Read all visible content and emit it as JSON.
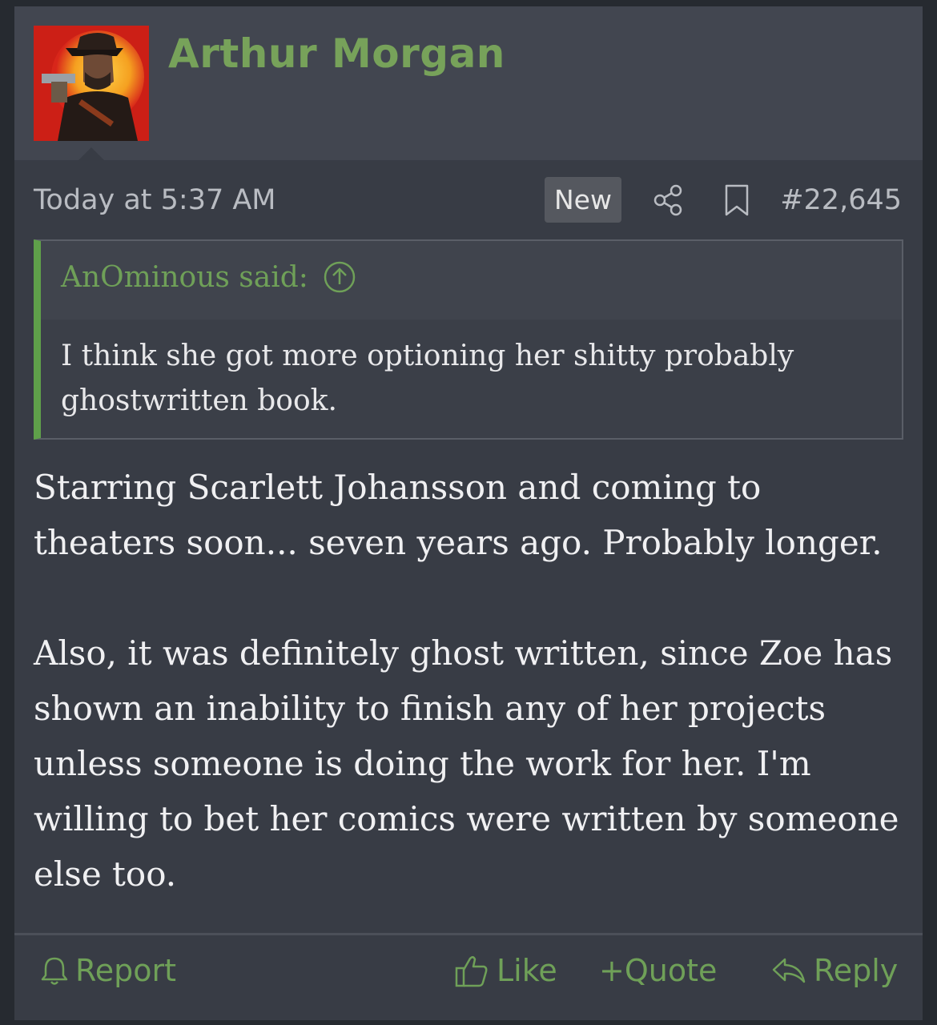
{
  "post": {
    "author": "Arthur Morgan",
    "date": "Today at 5:37 AM",
    "new_badge": "New",
    "post_number": "#22,645"
  },
  "quote": {
    "author_label": "AnOminous said:",
    "text": "I think she got more optioning her shitty probably ghostwritten book."
  },
  "body": {
    "paragraph_1": "Starring Scarlett Johansson and coming to theaters soon... seven years ago. Probably longer.",
    "paragraph_2": "Also, it was definitely ghost written, since Zoe has shown an inability to finish any of her projects unless someone is doing the work for her. I'm willing to bet her comics were written by someone else too."
  },
  "actions": {
    "report": "Report",
    "like": "Like",
    "quote": "+Quote",
    "reply": "Reply"
  },
  "colors": {
    "accent_green": "#77a25a",
    "background": "#383c45",
    "header": "#424650"
  }
}
